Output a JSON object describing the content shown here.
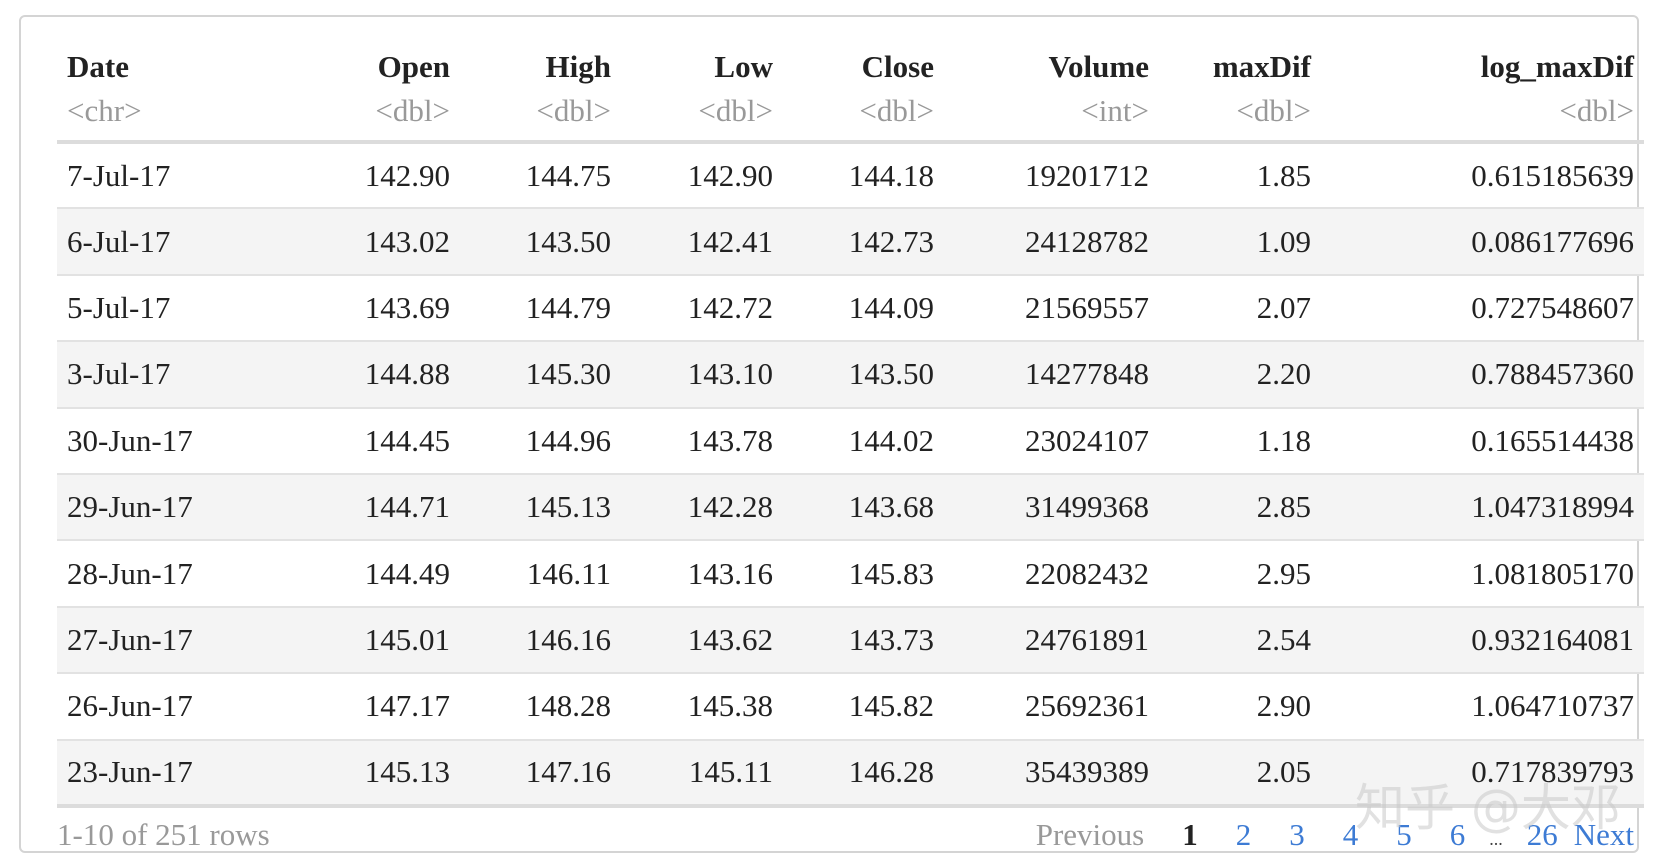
{
  "columns": [
    {
      "name": "Date",
      "type": "<chr>"
    },
    {
      "name": "Open",
      "type": "<dbl>"
    },
    {
      "name": "High",
      "type": "<dbl>"
    },
    {
      "name": "Low",
      "type": "<dbl>"
    },
    {
      "name": "Close",
      "type": "<dbl>"
    },
    {
      "name": "Volume",
      "type": "<int>"
    },
    {
      "name": "maxDif",
      "type": "<dbl>"
    },
    {
      "name": "log_maxDif",
      "type": "<dbl>"
    }
  ],
  "rows": [
    [
      "7-Jul-17",
      "142.90",
      "144.75",
      "142.90",
      "144.18",
      "19201712",
      "1.85",
      "0.615185639"
    ],
    [
      "6-Jul-17",
      "143.02",
      "143.50",
      "142.41",
      "142.73",
      "24128782",
      "1.09",
      "0.086177696"
    ],
    [
      "5-Jul-17",
      "143.69",
      "144.79",
      "142.72",
      "144.09",
      "21569557",
      "2.07",
      "0.727548607"
    ],
    [
      "3-Jul-17",
      "144.88",
      "145.30",
      "143.10",
      "143.50",
      "14277848",
      "2.20",
      "0.788457360"
    ],
    [
      "30-Jun-17",
      "144.45",
      "144.96",
      "143.78",
      "144.02",
      "23024107",
      "1.18",
      "0.165514438"
    ],
    [
      "29-Jun-17",
      "144.71",
      "145.13",
      "142.28",
      "143.68",
      "31499368",
      "2.85",
      "1.047318994"
    ],
    [
      "28-Jun-17",
      "144.49",
      "146.11",
      "143.16",
      "145.83",
      "22082432",
      "2.95",
      "1.081805170"
    ],
    [
      "27-Jun-17",
      "145.01",
      "146.16",
      "143.62",
      "143.73",
      "24761891",
      "2.54",
      "0.932164081"
    ],
    [
      "26-Jun-17",
      "147.17",
      "148.28",
      "145.38",
      "145.82",
      "25692361",
      "2.90",
      "1.064710737"
    ],
    [
      "23-Jun-17",
      "145.13",
      "147.16",
      "145.11",
      "146.28",
      "35439389",
      "2.05",
      "0.717839793"
    ]
  ],
  "footer": {
    "info": "1-10 of 251 rows",
    "previous": "Previous",
    "pages": [
      "1",
      "2",
      "3",
      "4",
      "5",
      "6"
    ],
    "ellipsis": "...",
    "last_page": "26",
    "next": "Next",
    "current_page": "1"
  },
  "watermark": "知乎 @大邓",
  "colors": {
    "link": "#3d7bd4",
    "muted": "#999999",
    "stripe": "#f4f4f4"
  }
}
